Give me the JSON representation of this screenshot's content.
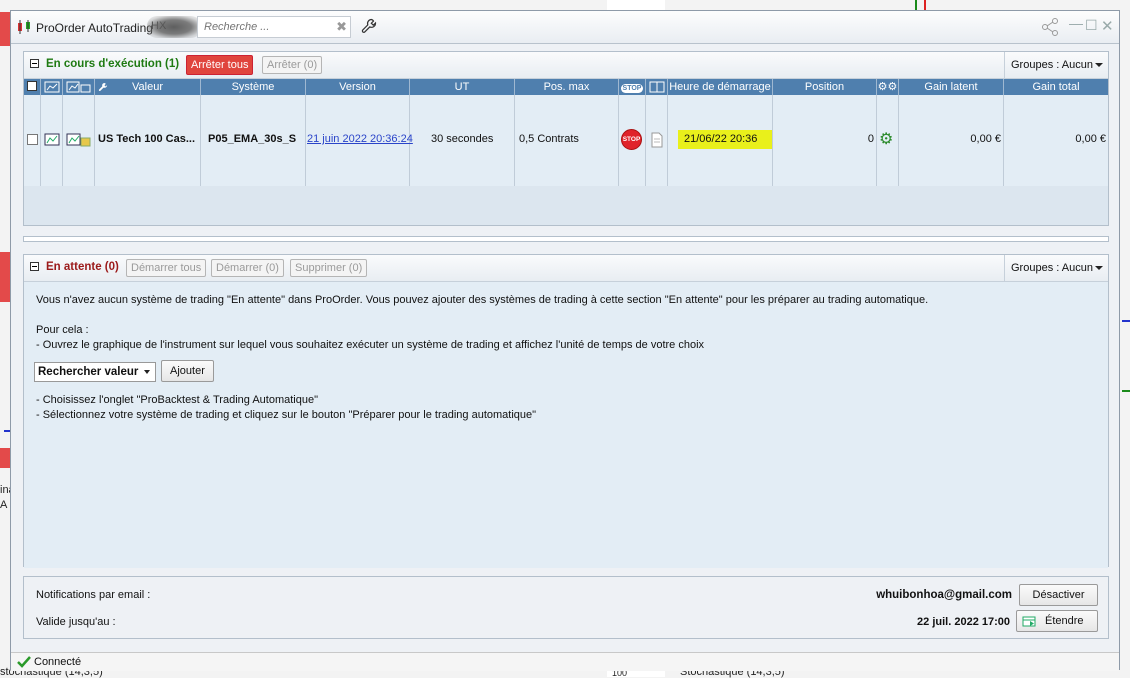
{
  "window": {
    "title": "ProOrder AutoTrading",
    "account_fragment": "HX",
    "search_placeholder": "Recherche ..."
  },
  "running": {
    "title": "En cours d'exécution (1)",
    "stop_all_label": "Arrêter tous",
    "stop_label": "Arrêter (0)",
    "groups_label": "Groupes : Aucun",
    "columns": [
      "Valeur",
      "Système",
      "Version",
      "UT",
      "Pos. max",
      "Heure de démarrage",
      "Position",
      "Gain latent",
      "Gain total"
    ],
    "stop_col_badge": "STOP",
    "row": {
      "valeur": "US Tech 100 Cas...",
      "systeme": "P05_EMA_30s_S",
      "version": "21 juin 2022 20:36:24",
      "ut": "30 secondes",
      "pos_max": "0,5 Contrats",
      "stop_badge": "STOP",
      "heure": "21/06/22 20:36",
      "position": "0",
      "gain_latent": "0,00 €",
      "gain_total": "0,00 €"
    }
  },
  "pending": {
    "title": "En attente (0)",
    "start_all_label": "Démarrer tous",
    "start_label": "Démarrer (0)",
    "delete_label": "Supprimer (0)",
    "groups_label": "Groupes : Aucun",
    "text1": "Vous n'avez aucun système de trading \"En attente\" dans ProOrder. Vous pouvez ajouter des systèmes de trading à cette section \"En attente\" pour les préparer au trading automatique.",
    "text2": "Pour cela :",
    "text3": "- Ouvrez le graphique de l'instrument sur lequel vous souhaitez exécuter un système de trading et affichez l'unité de temps de votre choix",
    "select_label": "Rechercher valeur",
    "add_label": "Ajouter",
    "text4": "- Choisissez l'onglet \"ProBacktest & Trading Automatique\"",
    "text5": "- Sélectionnez votre système de trading et cliquez sur le bouton \"Préparer pour le trading automatique\""
  },
  "notifications": {
    "email_label": "Notifications par email :",
    "email": "whuibonhoa@gmail.com",
    "deactivate_label": "Désactiver",
    "valid_label": "Valide jusqu'au :",
    "valid_date": "22 juil. 2022 17:00",
    "extend_label": "Étendre"
  },
  "status": {
    "text": "Connecté"
  },
  "background": {
    "left_text_1": "ina",
    "left_text_2": "A",
    "bottom_left": "stochastique (14,3,5)",
    "bottom_mid": "100",
    "bottom_right": "Stochastique (14,3,5)"
  },
  "colors": {
    "header_blue": "#4f7fae",
    "running_green": "#1e7a12",
    "pending_red": "#9b1a1a",
    "highlight_yellow": "#e9f01b",
    "stop_red": "#e0453d"
  }
}
